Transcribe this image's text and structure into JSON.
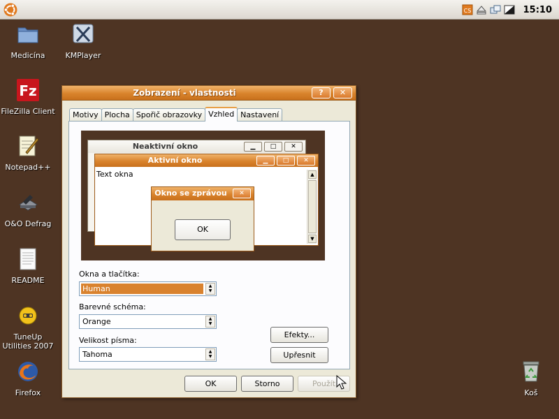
{
  "top_panel": {
    "clock": "15:10",
    "tray_icons": [
      "cs-icon",
      "eject-icon",
      "network-icon",
      "battery-icon"
    ]
  },
  "desktop": {
    "icons": [
      {
        "label": "Medicína",
        "icon": "folder-icon"
      },
      {
        "label": "KMPlayer",
        "icon": "kmplayer-icon"
      },
      {
        "label": "FileZilla Client",
        "icon": "filezilla-icon"
      },
      {
        "label": "Notepad++",
        "icon": "notepad-icon"
      },
      {
        "label": "O&O Defrag",
        "icon": "defrag-icon"
      },
      {
        "label": "README",
        "icon": "document-icon"
      },
      {
        "label": "TuneUp Utilities 2007",
        "icon": "tuneup-icon"
      },
      {
        "label": "Firefox",
        "icon": "firefox-icon"
      },
      {
        "label": "Koš",
        "icon": "trash-icon"
      }
    ]
  },
  "dialog": {
    "title": "Zobrazení - vlastnosti",
    "help_label": "?",
    "close_label": "✕",
    "tabs": [
      {
        "label": "Motivy"
      },
      {
        "label": "Plocha"
      },
      {
        "label": "Spořič obrazovky"
      },
      {
        "label": "Vzhled"
      },
      {
        "label": "Nastavení"
      }
    ],
    "active_tab": "Vzhled",
    "preview": {
      "inactive_title": "Neaktivní okno",
      "active_title": "Aktivní okno",
      "text": "Text okna",
      "msg_title": "Okno se zprávou",
      "msg_ok": "OK"
    },
    "fields": {
      "windows_label": "Okna a tlačítka:",
      "windows_value": "Human",
      "scheme_label": "Barevné schéma:",
      "scheme_value": "Orange",
      "font_label": "Velikost písma:",
      "font_value": "Tahoma"
    },
    "effects_label": "Efekty...",
    "advanced_label": "Upřesnit",
    "ok_label": "OK",
    "cancel_label": "Storno",
    "apply_label": "Použít"
  },
  "colors": {
    "desktop": "#4e3423",
    "accent": "#d9822e"
  }
}
